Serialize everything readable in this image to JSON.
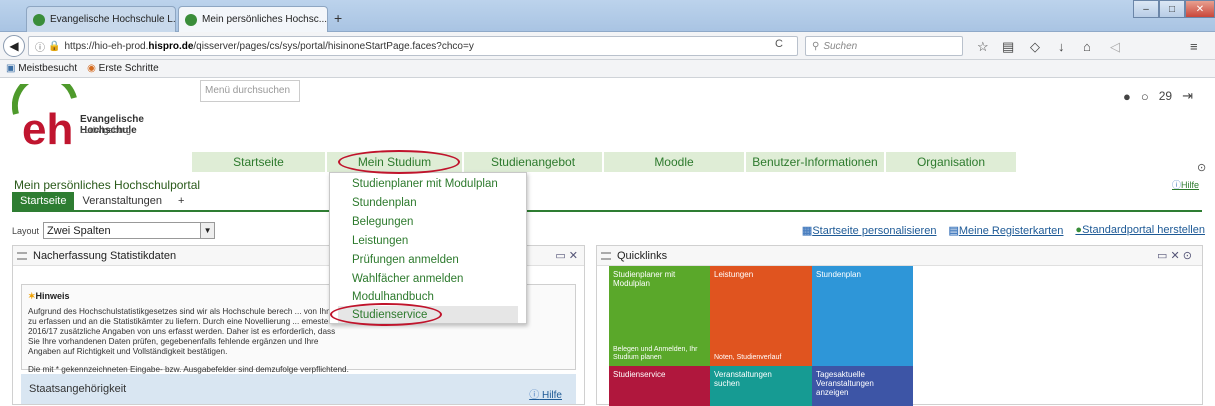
{
  "browser": {
    "tabs": [
      {
        "label": "Evangelische Hochschule L..."
      },
      {
        "label": "Mein persönliches Hochsc..."
      }
    ],
    "new_tab": "+",
    "url_host_prefix": "https://hio-eh-prod.",
    "url_host_bold": "hispro.de",
    "url_path": "/qisserver/pages/cs/sys/portal/hisinoneStartPage.faces?chco=y",
    "search_placeholder": "Suchen",
    "bookmarks": [
      "Meistbesucht",
      "Erste Schritte"
    ]
  },
  "header": {
    "logo_line1": "Evangelische Hochschule",
    "logo_line2": "Ludwigsburg",
    "menu_search_placeholder": "Menü durchsuchen",
    "notifications_count": "29"
  },
  "main_menu": [
    {
      "label": "Startseite"
    },
    {
      "label": "Mein Studium"
    },
    {
      "label": "Studienangebot"
    },
    {
      "label": "Moodle"
    },
    {
      "label": "Benutzer-Informationen"
    },
    {
      "label": "Organisation"
    }
  ],
  "dropdown": [
    "Studienplaner mit Modulplan",
    "Stundenplan",
    "Belegungen",
    "Leistungen",
    "Prüfungen anmelden",
    "Wahlfächer anmelden",
    "Modulhandbuch",
    "Studienservice"
  ],
  "portal": {
    "title": "Mein persönliches Hochschulportal",
    "help": "Hilfe",
    "tabs": [
      "Startseite",
      "Veranstaltungen",
      "+"
    ],
    "layout_label": "Layout",
    "layout_value": "Zwei Spalten",
    "links": [
      "Startseite personalisieren",
      "Meine Registerkarten",
      "Standardportal herstellen"
    ]
  },
  "left_panel": {
    "title": "Nacherfassung Statistikdaten",
    "hinweis_title": "Hinweis",
    "hinweis_text": "Aufgrund des Hochschulstatistikgesetzes sind wir als Hochschule berech ... von Ihnen zu erfassen und an die Statistikämter zu liefern. Durch eine Novellierung ... emester 2016/17 zusätzliche Angaben von uns erfasst werden. Daher ist es erforderlich, dass Sie Ihre vorhandenen Daten prüfen, gegebenenfalls fehlende ergänzen und Ihre Angaben auf Richtigkeit und Vollständigkeit bestätigen.",
    "pflicht_text": "Die mit * gekennzeichneten Eingabe- bzw. Ausgabefelder sind demzufolge verpflichtend.",
    "section": "Staatsangehörigkeit",
    "help": "Hilfe"
  },
  "quicklinks": {
    "title": "Quicklinks",
    "tiles": [
      {
        "title": "Studienplaner mit Modulplan",
        "sub": "Belegen und Anmelden, Ihr Studium planen",
        "color": "#5aa82a"
      },
      {
        "title": "Leistungen",
        "sub": "Noten, Studienverlauf",
        "color": "#e0541f"
      },
      {
        "title": "Stundenplan",
        "sub": "",
        "color": "#2e96d8"
      },
      {
        "title": "Studienservice",
        "sub": "",
        "color": "#b0173d"
      },
      {
        "title": "Veranstaltungen suchen",
        "sub": "",
        "color": "#169b93"
      },
      {
        "title": "Tagesaktuelle Veranstaltungen anzeigen",
        "sub": "",
        "color": "#3d55a6"
      }
    ]
  }
}
